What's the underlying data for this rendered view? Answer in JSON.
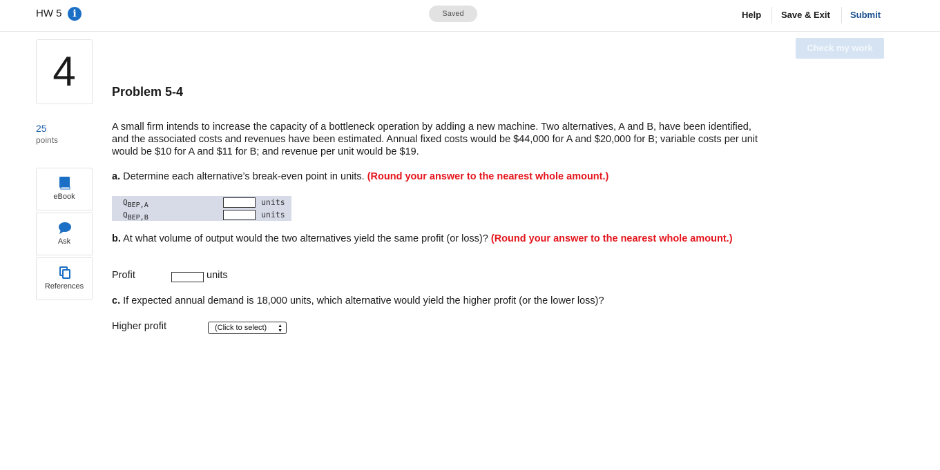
{
  "header": {
    "assignment_title": "HW 5",
    "info_icon": "info-icon",
    "saved_status": "Saved",
    "help_label": "Help",
    "save_exit_label": "Save & Exit",
    "submit_label": "Submit"
  },
  "check_button_label": "Check my work",
  "sidebar": {
    "question_number": "4",
    "points_value": "25",
    "points_label": "points",
    "tools": [
      {
        "label": "eBook",
        "icon": "book-icon"
      },
      {
        "label": "Ask",
        "icon": "chat-bubble-icon"
      },
      {
        "label": "References",
        "icon": "copy-pages-icon"
      }
    ]
  },
  "problem": {
    "title": "Problem 5-4",
    "statement": "A small firm intends to increase the capacity of a bottleneck operation by adding a new machine. Two alternatives, A and B, have been identified, and the associated costs and revenues have been estimated. Annual fixed costs would be $44,000 for A and $20,000 for B; variable costs per unit would be $10 for A and $11 for B; and revenue per unit would be $19.",
    "part_a": {
      "prefix": "a.",
      "text": "Determine each alternative’s break-even point in units.",
      "instruction": "(Round your answer to the nearest whole amount.)",
      "rows": [
        {
          "label_main": "Q",
          "label_sub": "BEP,A",
          "value": "",
          "unit": "units"
        },
        {
          "label_main": "Q",
          "label_sub": "BEP,B",
          "value": "",
          "unit": "units"
        }
      ]
    },
    "part_b": {
      "prefix": "b.",
      "text": "At what volume of output would the two alternatives yield the same profit (or loss)?",
      "instruction": "(Round your answer to the nearest whole amount.)",
      "field_label": "Profit",
      "value": "",
      "unit": "units"
    },
    "part_c": {
      "prefix": "c.",
      "text": "If expected annual demand is 18,000 units, which alternative would yield the higher profit (or the lower loss)?",
      "field_label": "Higher profit",
      "select_value": "(Click to select)"
    }
  },
  "colors": {
    "accent_blue": "#1b6fc4",
    "submit_blue": "#1b4f8f",
    "instruction_red": "#e4151c",
    "table_bg": "#d7dbe8",
    "check_button_bg": "#d5e3f3"
  }
}
